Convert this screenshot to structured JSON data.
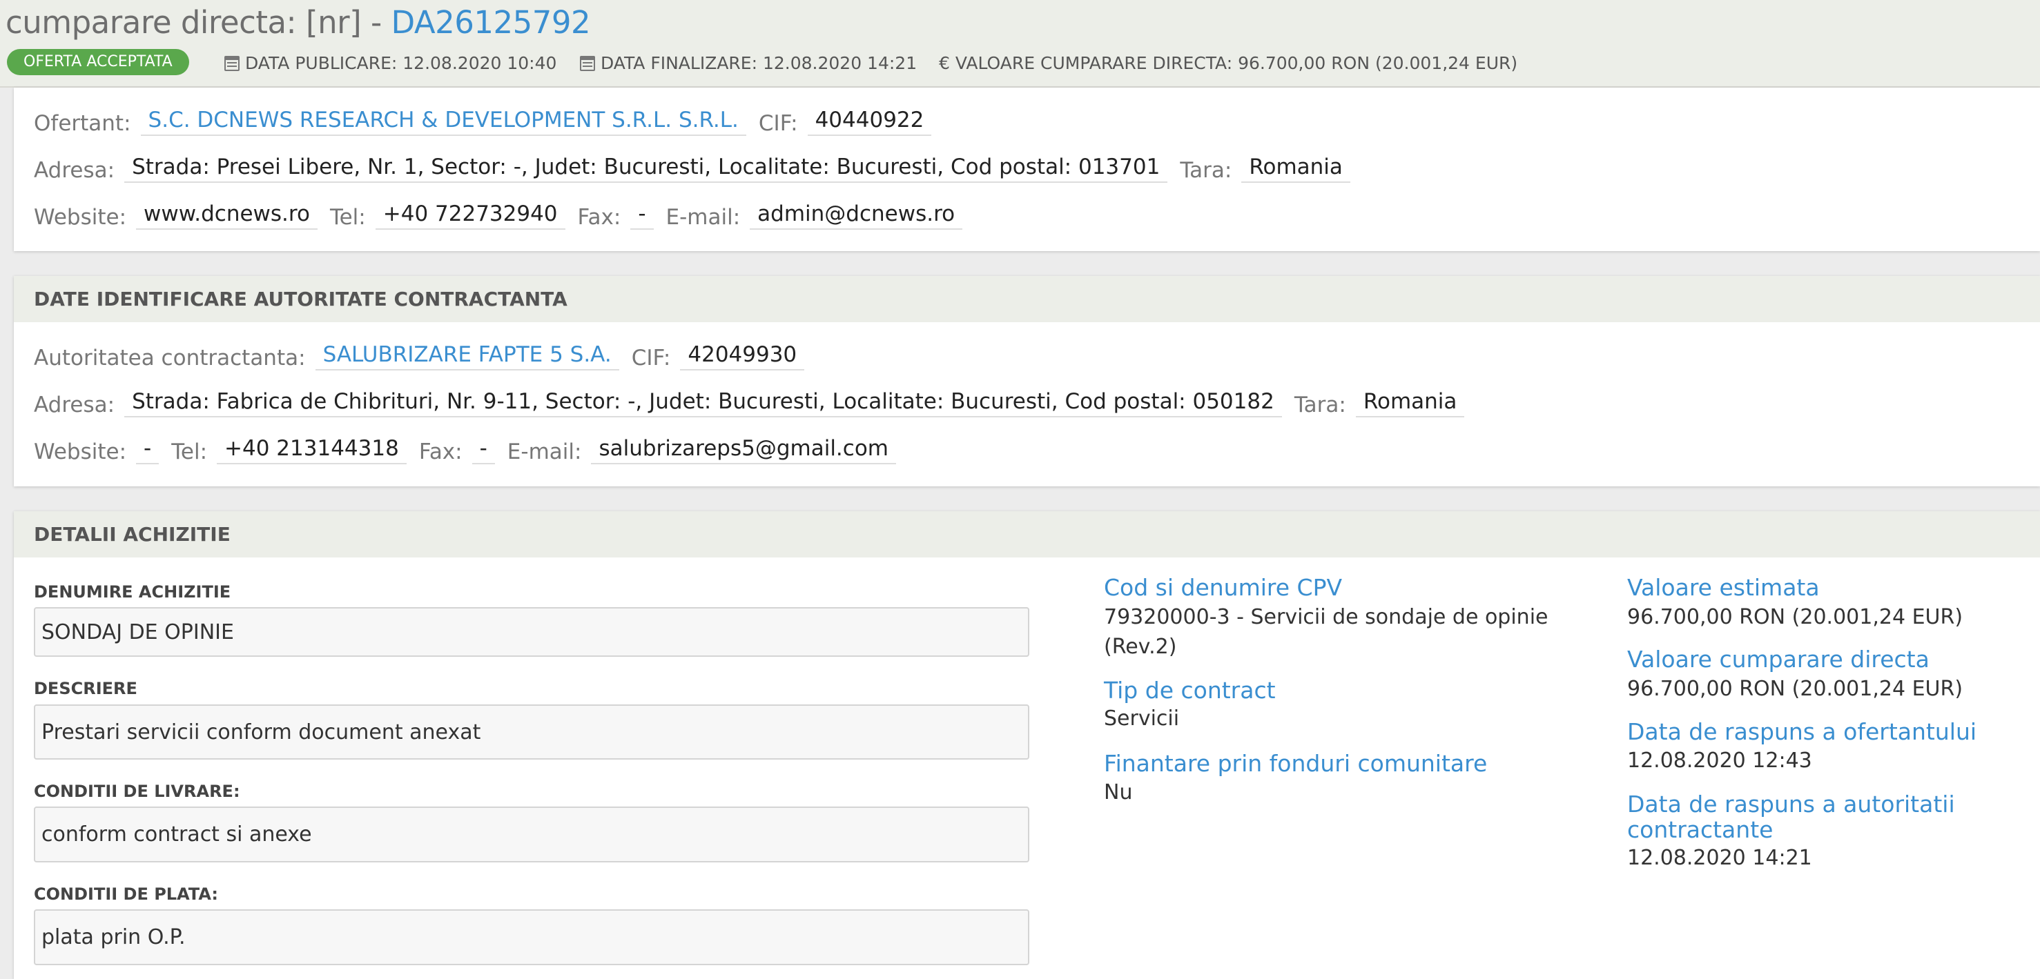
{
  "header": {
    "title_prefix": "cumparare directa: [nr] - ",
    "title_id": "DA26125792",
    "status": "OFERTA ACCEPTATA",
    "data_publicare": "DATA PUBLICARE: 12.08.2020 10:40",
    "data_finalizare": "DATA FINALIZARE: 12.08.2020 14:21",
    "valoare_symbol": "€",
    "valoare": "VALOARE CUMPARARE DIRECTA: 96.700,00  RON (20.001,24  EUR)"
  },
  "ofertant": {
    "ofertant_label": "Ofertant:",
    "ofertant_value": "S.C. DCNEWS RESEARCH & DEVELOPMENT S.R.L. S.R.L.",
    "cif_label": "CIF:",
    "cif_value": "40440922",
    "adresa_label": "Adresa:",
    "adresa_value": "Strada: Presei Libere, Nr. 1, Sector: -, Judet: Bucuresti, Localitate: Bucuresti, Cod postal: 013701",
    "tara_label": "Tara:",
    "tara_value": "Romania",
    "website_label": "Website:",
    "website_value": "www.dcnews.ro",
    "tel_label": "Tel:",
    "tel_value": "+40 722732940",
    "fax_label": "Fax:",
    "fax_value": "-",
    "email_label": "E-mail:",
    "email_value": "admin@dcnews.ro"
  },
  "autoritate": {
    "section_title": "DATE IDENTIFICARE AUTORITATE CONTRACTANTA",
    "autoritate_label": "Autoritatea contractanta:",
    "autoritate_value": "SALUBRIZARE FAPTE 5 S.A.",
    "cif_label": "CIF:",
    "cif_value": "42049930",
    "adresa_label": "Adresa:",
    "adresa_value": "Strada: Fabrica de Chibrituri, Nr. 9-11, Sector: -, Judet: Bucuresti, Localitate: Bucuresti, Cod postal: 050182",
    "tara_label": "Tara:",
    "tara_value": "Romania",
    "website_label": "Website:",
    "website_value": "-",
    "tel_label": "Tel:",
    "tel_value": "+40 213144318",
    "fax_label": "Fax:",
    "fax_value": "-",
    "email_label": "E-mail:",
    "email_value": "salubrizareps5@gmail.com"
  },
  "detalii": {
    "section_title": "DETALII ACHIZITIE",
    "denumire_label": "DENUMIRE ACHIZITIE",
    "denumire_value": "SONDAJ DE OPINIE",
    "descriere_label": "DESCRIERE",
    "descriere_value": "Prestari servicii conform document anexat",
    "livrare_label": "CONDITII DE LIVRARE:",
    "livrare_value": "conform contract si anexe",
    "plata_label": "CONDITII DE PLATA:",
    "plata_value": "plata prin O.P.",
    "cpv_title": "Cod si denumire CPV",
    "cpv_value_line1": "79320000-3 - Servicii de sondaje de opinie",
    "cpv_value_line2": "(Rev.2)",
    "tip_title": "Tip de contract",
    "tip_value": "Servicii",
    "finantare_title": "Finantare prin fonduri comunitare",
    "finantare_value": "Nu",
    "estimata_title": "Valoare estimata",
    "estimata_value": "96.700,00  RON (20.001,24  EUR)",
    "cumparare_title": "Valoare cumparare directa",
    "cumparare_value": "96.700,00  RON (20.001,24  EUR)",
    "raspuns_ofertant_title": "Data de raspuns a ofertantului",
    "raspuns_ofertant_value": "12.08.2020 12:43",
    "raspuns_autoritate_title_line1": "Data de raspuns a autoritatii",
    "raspuns_autoritate_title_line2": "contractante",
    "raspuns_autoritate_value": "12.08.2020 14:21"
  }
}
